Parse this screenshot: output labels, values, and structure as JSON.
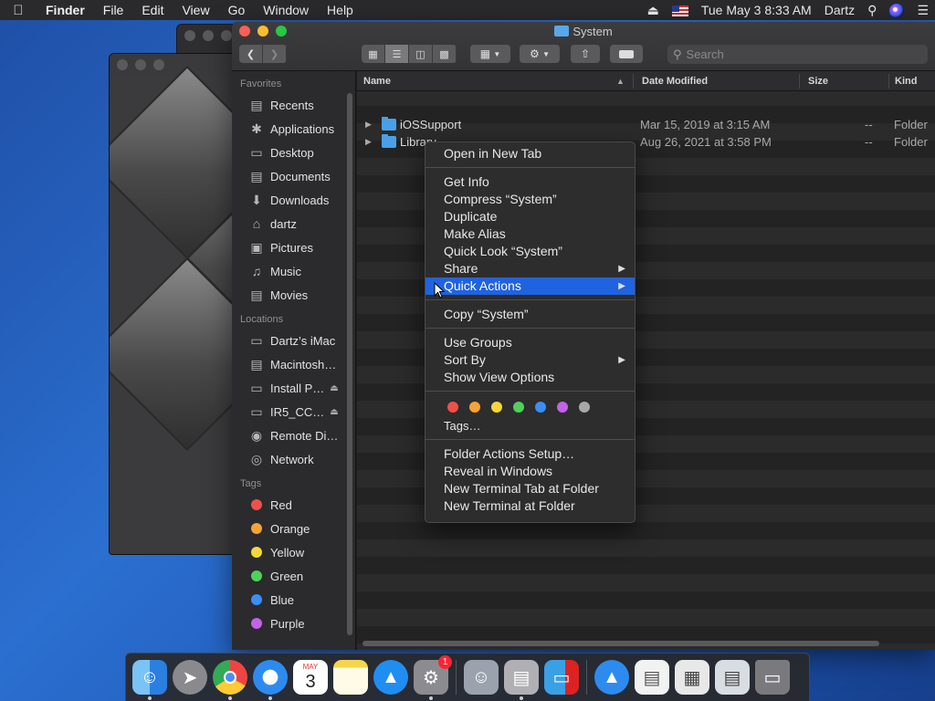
{
  "menubar": {
    "apple": "",
    "items": [
      "Finder",
      "File",
      "Edit",
      "View",
      "Go",
      "Window",
      "Help"
    ],
    "clock": "Tue May 3  8:33 AM",
    "user": "Dartz"
  },
  "window": {
    "title": "System",
    "search_placeholder": "Search"
  },
  "sidebar": {
    "favorites_header": "Favorites",
    "favorites": [
      {
        "label": "Recents",
        "icon": "recents-icon"
      },
      {
        "label": "Applications",
        "icon": "applications-icon"
      },
      {
        "label": "Desktop",
        "icon": "desktop-icon"
      },
      {
        "label": "Documents",
        "icon": "documents-icon"
      },
      {
        "label": "Downloads",
        "icon": "downloads-icon"
      },
      {
        "label": "dartz",
        "icon": "home-icon"
      },
      {
        "label": "Pictures",
        "icon": "pictures-icon"
      },
      {
        "label": "Music",
        "icon": "music-icon"
      },
      {
        "label": "Movies",
        "icon": "movies-icon"
      }
    ],
    "locations_header": "Locations",
    "locations": [
      {
        "label": "Dartz’s iMac",
        "icon": "imac-icon"
      },
      {
        "label": "Macintosh…",
        "icon": "disk-icon"
      },
      {
        "label": "Install P…",
        "icon": "disk-icon",
        "eject": true
      },
      {
        "label": "IR5_CC…",
        "icon": "disk-icon",
        "eject": true
      },
      {
        "label": "Remote Di…",
        "icon": "remote-disc-icon"
      },
      {
        "label": "Network",
        "icon": "network-icon"
      }
    ],
    "tags_header": "Tags",
    "tags": [
      {
        "label": "Red",
        "color": "#f0504a"
      },
      {
        "label": "Orange",
        "color": "#f7a234"
      },
      {
        "label": "Yellow",
        "color": "#f5d73a"
      },
      {
        "label": "Green",
        "color": "#4fd15a"
      },
      {
        "label": "Blue",
        "color": "#3a8ef5"
      },
      {
        "label": "Purple",
        "color": "#c462e8"
      }
    ]
  },
  "columns": {
    "name": "Name",
    "date_modified": "Date Modified",
    "size": "Size",
    "kind": "Kind"
  },
  "files": [
    {
      "name": "iOSSupport",
      "date": "Mar 15, 2019 at 3:15 AM",
      "size": "--",
      "kind": "Folder"
    },
    {
      "name": "Library",
      "date": "Aug 26, 2021 at 3:58 PM",
      "size": "--",
      "kind": "Folder"
    }
  ],
  "context_menu": {
    "open_new_tab": "Open in New Tab",
    "get_info": "Get Info",
    "compress": "Compress “System”",
    "duplicate": "Duplicate",
    "make_alias": "Make Alias",
    "quick_look": "Quick Look “System”",
    "share": "Share",
    "quick_actions": "Quick Actions",
    "copy": "Copy “System”",
    "use_groups": "Use Groups",
    "sort_by": "Sort By",
    "show_view_options": "Show View Options",
    "tag_colors": [
      "#f0504a",
      "#f7a234",
      "#f5d73a",
      "#4fd15a",
      "#3a8ef5",
      "#c462e8",
      "#a8a8a8"
    ],
    "tags": "Tags…",
    "folder_actions_setup": "Folder Actions Setup…",
    "reveal_in_windows": "Reveal in Windows",
    "new_terminal_tab": "New Terminal Tab at Folder",
    "new_terminal": "New Terminal at Folder"
  },
  "dock": {
    "calendar_month": "MAY",
    "calendar_day": "3",
    "settings_badge": "1"
  }
}
